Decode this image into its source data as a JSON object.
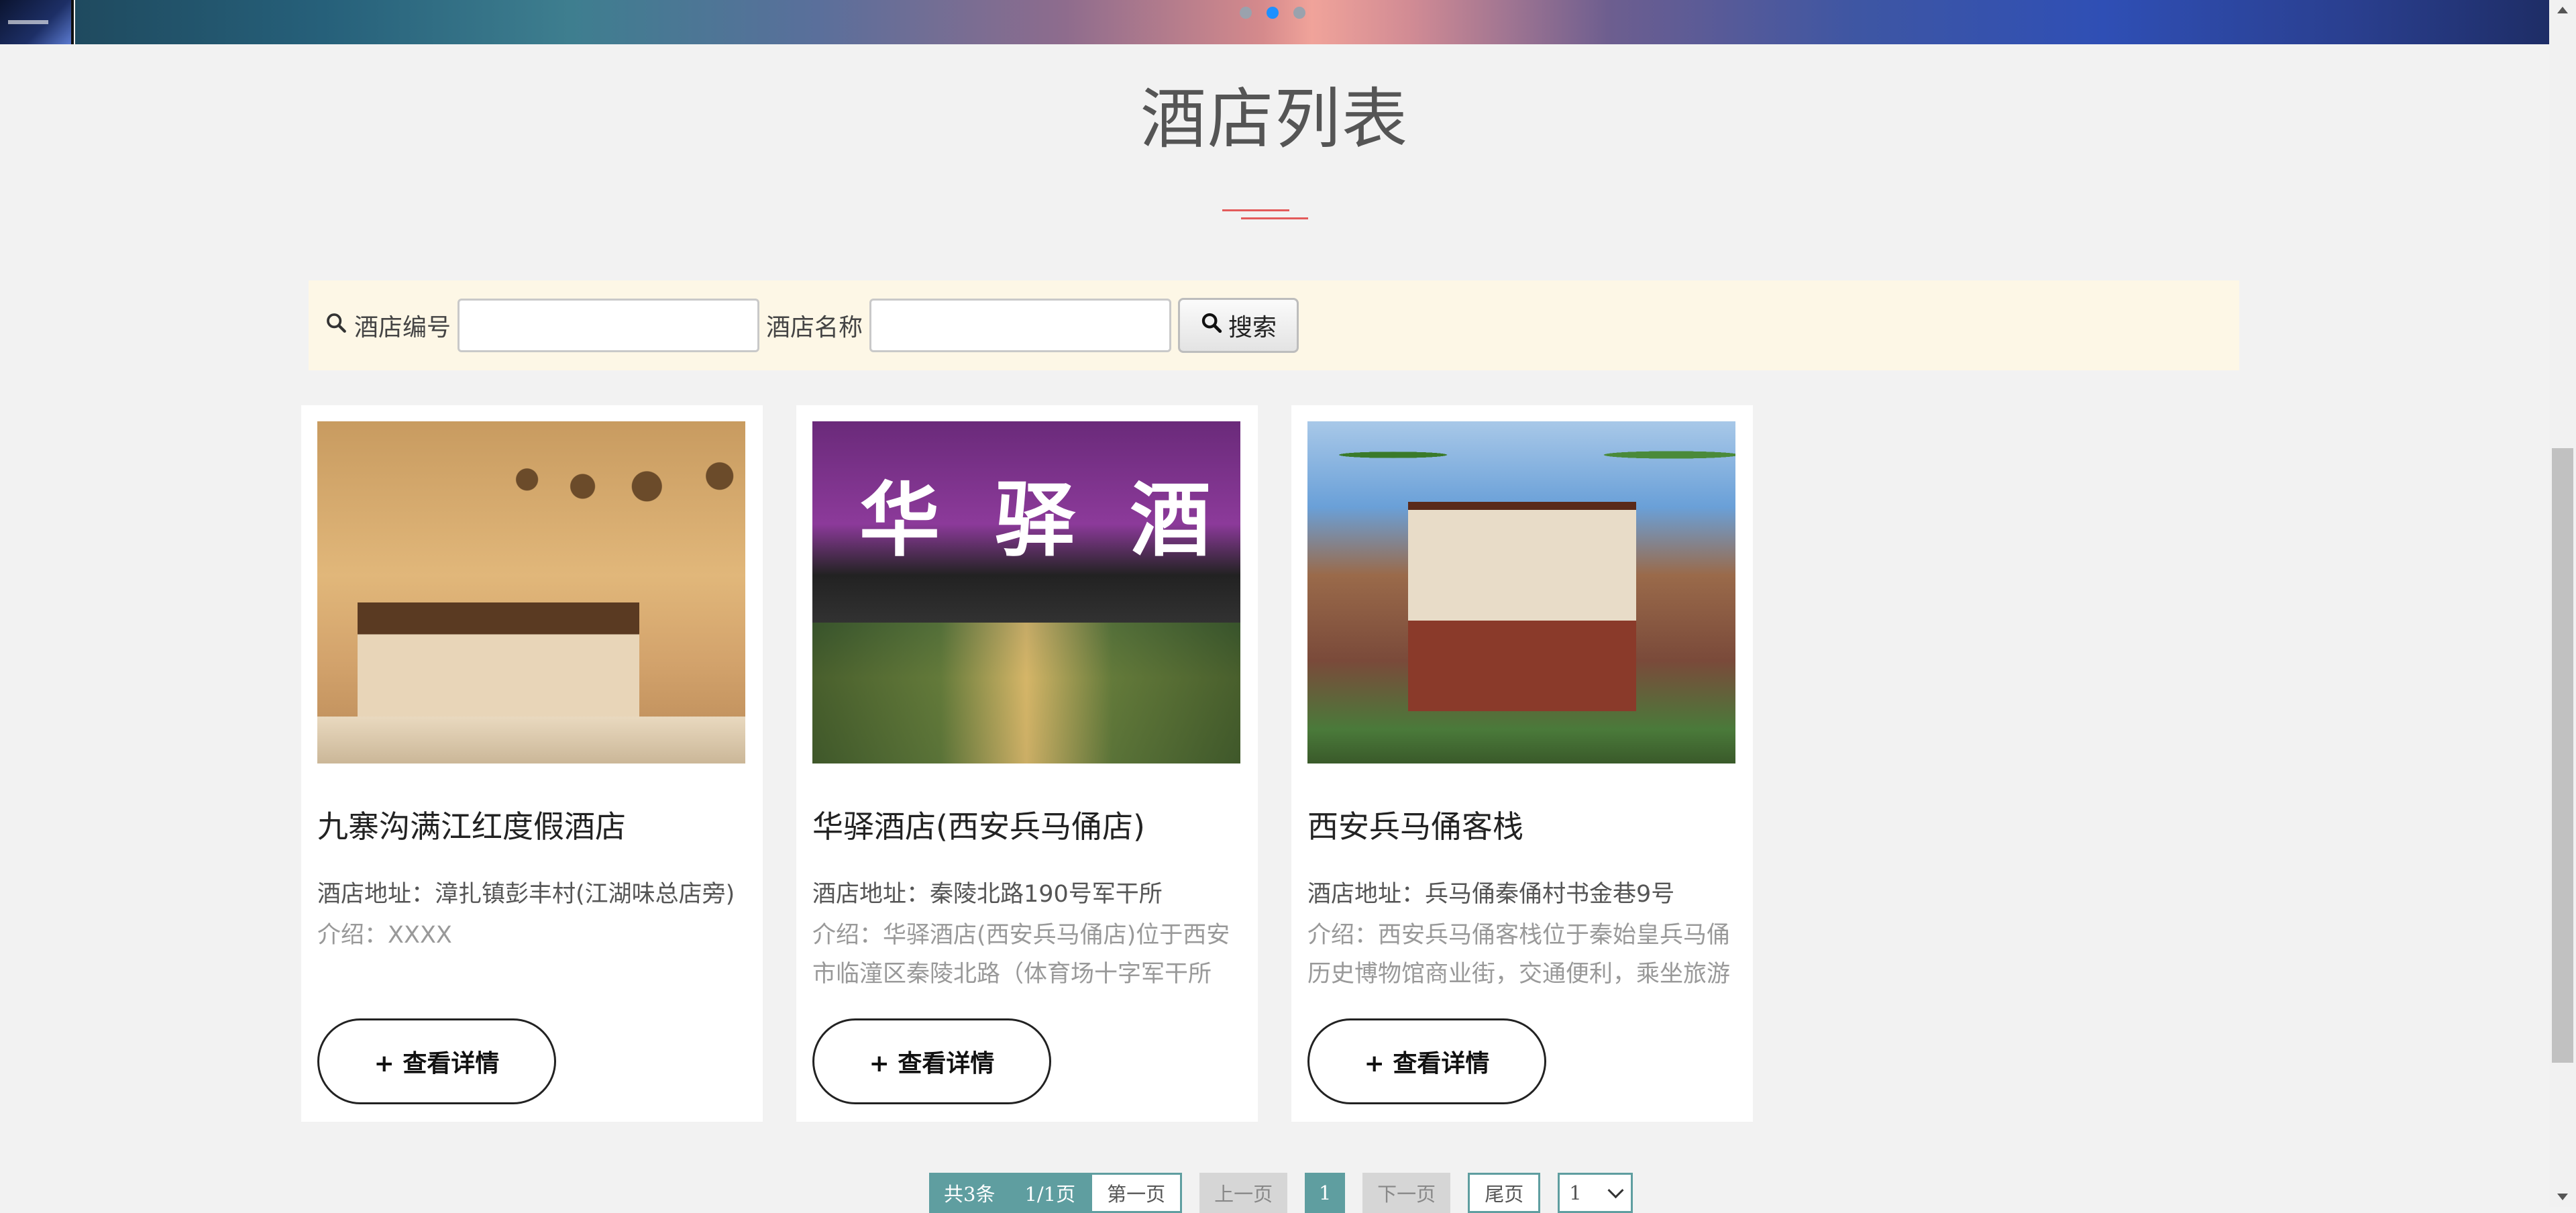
{
  "banner": {
    "dot_count": 3,
    "active_dot": 2
  },
  "page_title": "酒店列表",
  "search": {
    "hotel_id_label": "酒店编号",
    "hotel_id_value": "",
    "hotel_name_label": "酒店名称",
    "hotel_name_value": "",
    "button_label": "搜索"
  },
  "hotels": [
    {
      "name": "九寨沟满江红度假酒店",
      "address": "酒店地址：漳扎镇彭丰村(江湖味总店旁)",
      "intro": "介绍：XXXX",
      "detail_label": "+ 查看详情"
    },
    {
      "name": "华驿酒店(西安兵马俑店)",
      "address": "酒店地址：秦陵北路190号军干所",
      "intro": "介绍：华驿酒店(西安兵马俑店)位于西安市临潼区秦陵北路（体育场十字军干所",
      "detail_label": "+ 查看详情"
    },
    {
      "name": "西安兵马俑客栈",
      "address": "酒店地址：兵马俑秦俑村书金巷9号",
      "intro": "介绍：西安兵马俑客栈位于秦始皇兵马俑历史博物馆商业街，交通便利，乘坐旅游",
      "detail_label": "+ 查看详情"
    }
  ],
  "pagination": {
    "total_label": "共3条",
    "page_info": "1/1页",
    "first_label": "第一页",
    "prev_label": "上一页",
    "current_page": "1",
    "next_label": "下一页",
    "last_label": "尾页",
    "select_value": "1"
  },
  "colors": {
    "accent": "#5f9ea0",
    "title_deco": "#e35b5b",
    "search_bg": "#fdf7e6",
    "active_dot": "#1e90ff"
  }
}
